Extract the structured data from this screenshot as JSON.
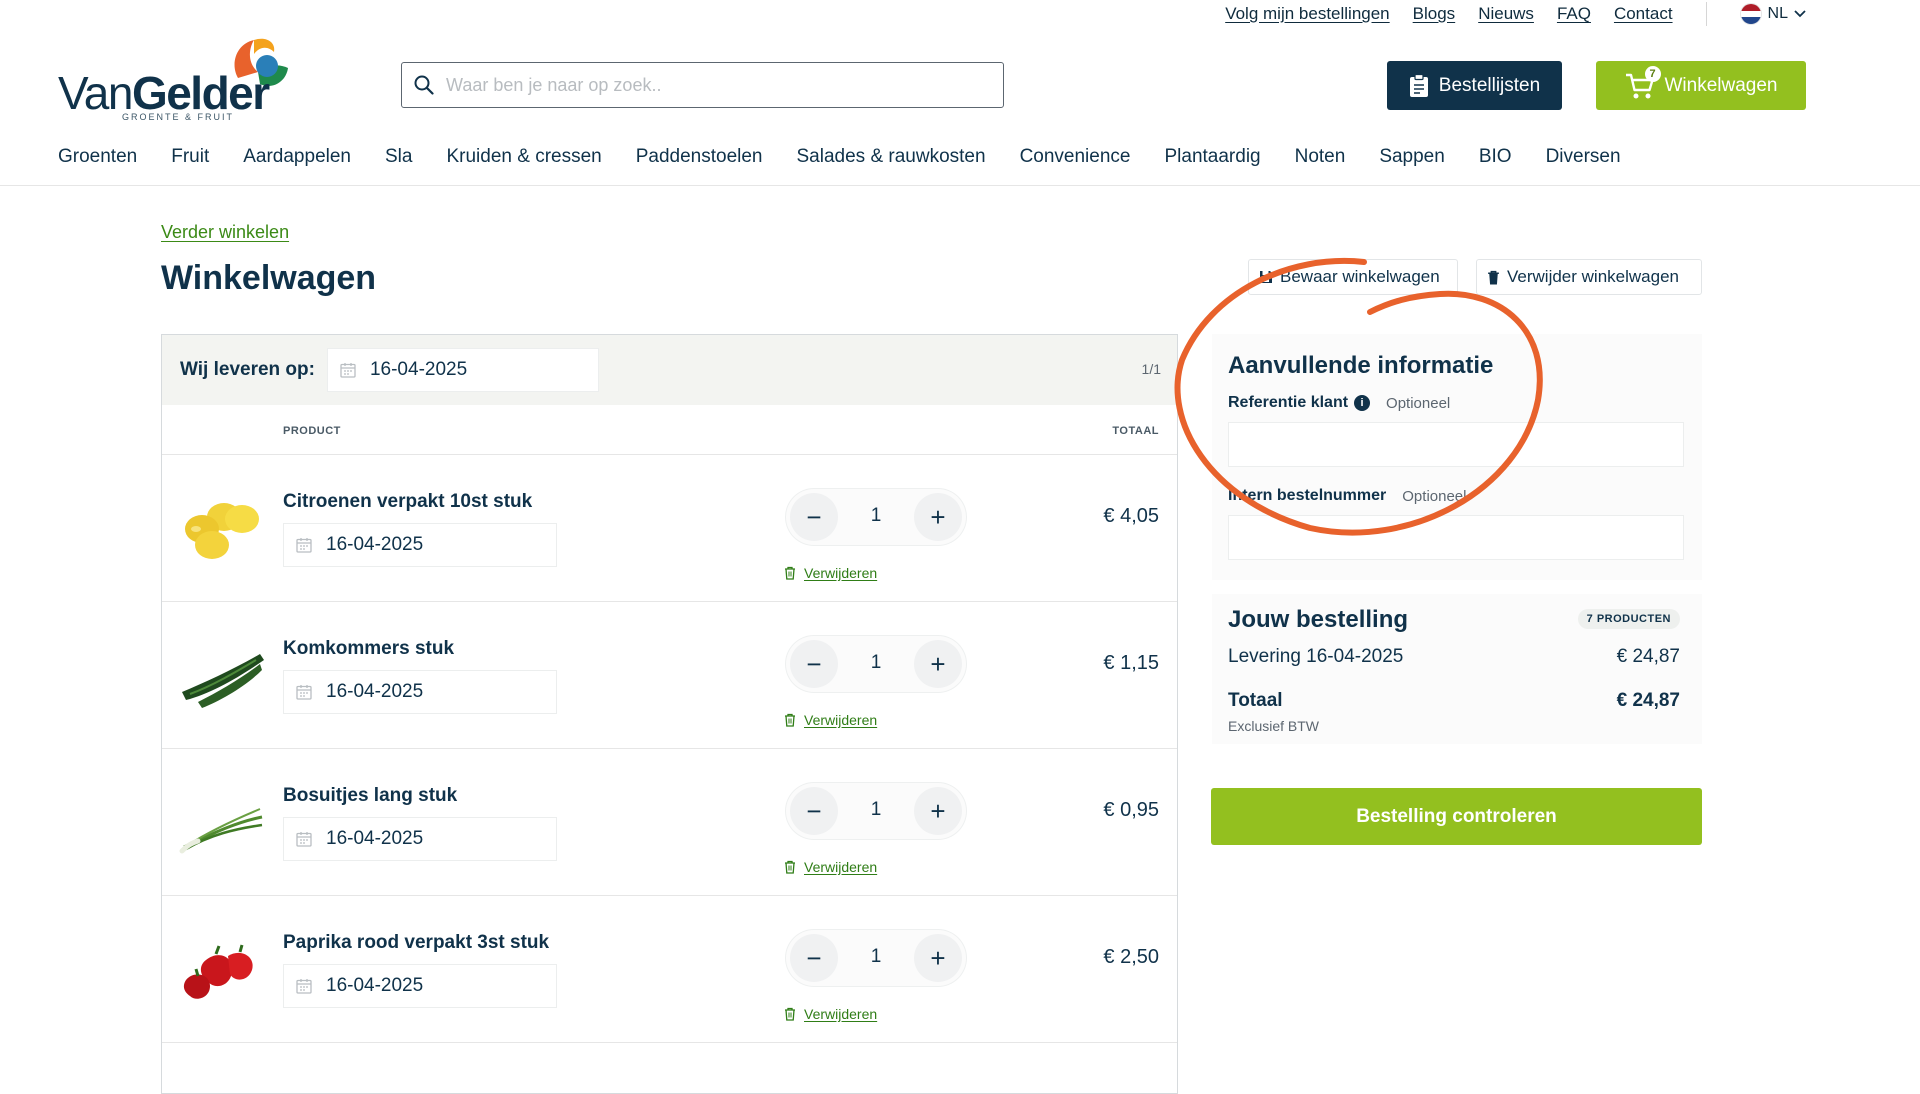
{
  "topbar": {
    "links": [
      "Volg mijn bestellingen",
      "Blogs",
      "Nieuws",
      "FAQ",
      "Contact"
    ],
    "language": "NL",
    "language_icon": "netherlands-flag-icon"
  },
  "logo": {
    "name_regular": "Van",
    "name_bold": "Gelder",
    "tagline": "GROENTE & FRUIT"
  },
  "search": {
    "placeholder": "Waar ben je naar op zoek..",
    "value": ""
  },
  "header": {
    "lists_label": "Bestellijsten",
    "cart_label": "Winkelwagen",
    "cart_count": "7"
  },
  "nav": [
    "Groenten",
    "Fruit",
    "Aardappelen",
    "Sla",
    "Kruiden & cressen",
    "Paddenstoelen",
    "Salades & rauwkosten",
    "Convenience",
    "Plantaardig",
    "Noten",
    "Sappen",
    "BIO",
    "Diversen"
  ],
  "page": {
    "continue_link": "Verder winkelen",
    "title": "Winkelwagen",
    "save_cart": "Bewaar winkelwagen",
    "delete_cart": "Verwijder winkelwagen"
  },
  "cart": {
    "deliver_label": "Wij leveren op:",
    "deliver_date": "16-04-2025",
    "pager": "1/1",
    "col_product": "PRODUCT",
    "col_total": "TOTAAL",
    "remove_label": "Verwijderen",
    "items": [
      {
        "name": "Citroenen verpakt 10st stuk",
        "date": "16-04-2025",
        "qty": "1",
        "price": "€ 4,05",
        "image": "lemons"
      },
      {
        "name": "Komkommers stuk",
        "date": "16-04-2025",
        "qty": "1",
        "price": "€ 1,15",
        "image": "cucumbers"
      },
      {
        "name": "Bosuitjes lang stuk",
        "date": "16-04-2025",
        "qty": "1",
        "price": "€ 0,95",
        "image": "spring-onions"
      },
      {
        "name": "Paprika rood verpakt 3st stuk",
        "date": "16-04-2025",
        "qty": "1",
        "price": "€ 2,50",
        "image": "red-peppers"
      }
    ]
  },
  "info": {
    "title": "Aanvullende informatie",
    "ref_label": "Referentie klant",
    "ref_optional": "Optioneel",
    "ref_value": "",
    "intern_label": "Intern bestelnummer",
    "intern_optional": "Optioneel",
    "intern_value": ""
  },
  "order": {
    "title": "Jouw bestelling",
    "badge": "7 PRODUCTEN",
    "delivery_label": "Levering 16-04-2025",
    "delivery_amount": "€ 24,87",
    "total_label": "Totaal",
    "total_amount": "€ 24,87",
    "excl": "Exclusief BTW",
    "check_button": "Bestelling controleren"
  },
  "colors": {
    "navy": "#10324a",
    "green": "#93c01f",
    "link_green": "#3b8a16",
    "annotation": "#e8622c"
  }
}
